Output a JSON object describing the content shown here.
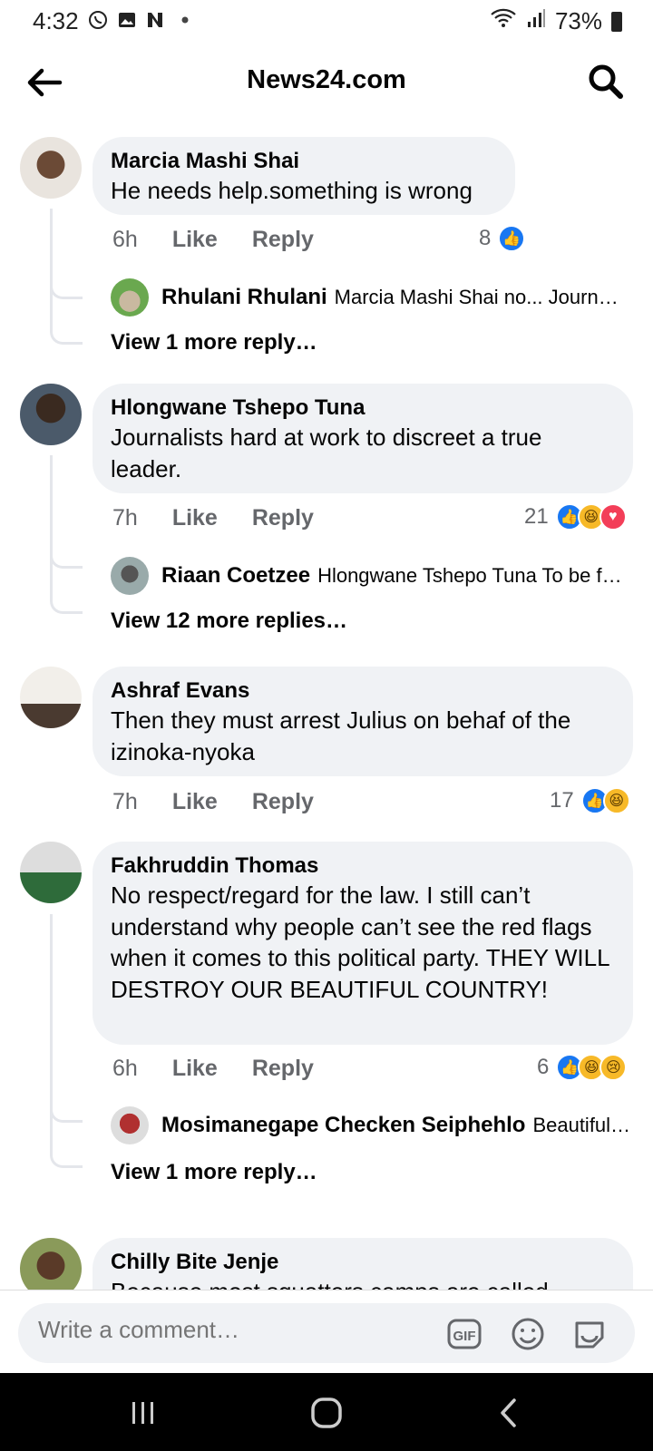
{
  "status": {
    "time": "4:32",
    "battery": "73%"
  },
  "header": {
    "title": "News24.com"
  },
  "comments": [
    {
      "author": "Marcia Mashi Shai",
      "text": "He needs help.something is wrong",
      "time": "6h",
      "like": "Like",
      "reply": "Reply",
      "reaction_count": "8",
      "replies": [
        {
          "author": "Rhulani Rhulani",
          "snippet": "Marcia Mashi Shai no... Journ…"
        }
      ],
      "view_more": "View 1 more reply…"
    },
    {
      "author": "Hlongwane Tshepo Tuna",
      "text": "Journalists hard at work to discreet a true leader.",
      "time": "7h",
      "like": "Like",
      "reply": "Reply",
      "reaction_count": "21",
      "replies": [
        {
          "author": "Riaan Coetzee",
          "snippet": "Hlongwane Tshepo Tuna To be f…"
        }
      ],
      "view_more": "View 12 more replies…"
    },
    {
      "author": "Ashraf Evans",
      "text": "Then they must arrest Julius on behaf of the izinoka-nyoka",
      "time": "7h",
      "like": "Like",
      "reply": "Reply",
      "reaction_count": "17"
    },
    {
      "author": "Fakhruddin Thomas",
      "text": "No respect/regard for the law. I still can’t understand why people can’t see the red flags when it comes to this political party. THEY WILL DESTROY OUR BEAUTIFUL COUNTRY!",
      "time": "6h",
      "like": "Like",
      "reply": "Reply",
      "reaction_count": "6",
      "replies": [
        {
          "author": "Mosimanegape Checken Seiphehlo",
          "snippet": "Beautiful…"
        }
      ],
      "view_more": "View 1 more reply…"
    },
    {
      "author": "Chilly Bite Jenje",
      "text": "Because most squatters camps are called"
    }
  ],
  "composer": {
    "placeholder": "Write a comment…",
    "gif_label": "GIF"
  },
  "colors": {
    "like": "#1877f2",
    "bubble": "#f0f2f5",
    "meta": "#65676b"
  }
}
